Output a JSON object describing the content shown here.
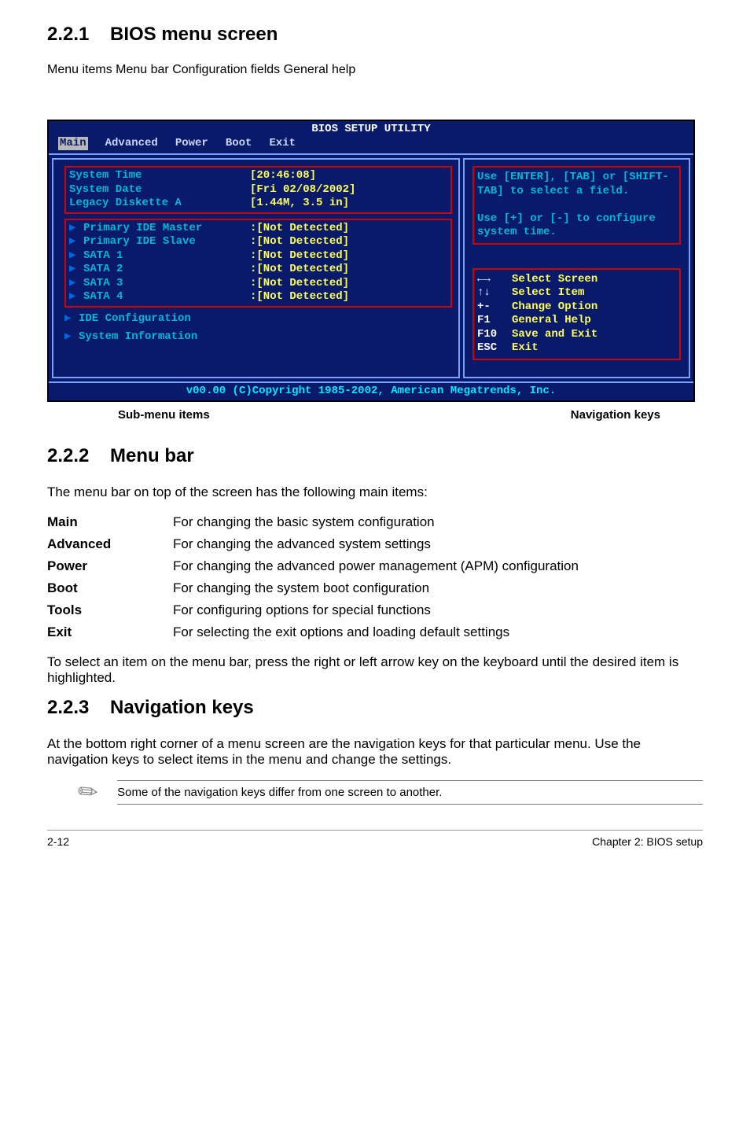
{
  "section221": {
    "num": "2.2.1",
    "title": "BIOS menu screen"
  },
  "anno": {
    "menu_items": "Menu items",
    "menu_bar": "Menu bar",
    "config_fields": "Configuration fields",
    "general_help": "General help",
    "sub_menu": "Sub-menu items",
    "nav_keys": "Navigation keys"
  },
  "bios": {
    "title": "BIOS SETUP UTILITY",
    "menubar": [
      "Main",
      "Advanced",
      "Power",
      "Boot",
      "Exit"
    ],
    "cfg": {
      "time_l": "System Time",
      "time_v": "[20:46:08]",
      "date_l": "System Date",
      "date_v": "[Fri 02/08/2002]",
      "disk_l": "Legacy Diskette A",
      "disk_v": "[1.44M, 3.5 in]"
    },
    "items": [
      {
        "l": "Primary IDE Master",
        "v": ":[Not Detected]"
      },
      {
        "l": "Primary IDE Slave",
        "v": ":[Not Detected]"
      },
      {
        "l": "SATA 1",
        "v": ":[Not Detected]"
      },
      {
        "l": "SATA 2",
        "v": ":[Not Detected]"
      },
      {
        "l": "SATA 3",
        "v": ":[Not Detected]"
      },
      {
        "l": "SATA 4",
        "v": ":[Not Detected]"
      }
    ],
    "sub": [
      "IDE Configuration",
      "System Information"
    ],
    "help": "Use [ENTER], [TAB] or [SHIFT-TAB] to select a field.\n\nUse [+] or [-] to configure system time.",
    "nav": [
      {
        "k": "←→",
        "d": "Select Screen"
      },
      {
        "k": "↑↓",
        "d": "Select Item"
      },
      {
        "k": "+-",
        "d": "Change Option"
      },
      {
        "k": "F1",
        "d": "General Help"
      },
      {
        "k": "F10",
        "d": "Save and Exit"
      },
      {
        "k": "ESC",
        "d": "Exit"
      }
    ],
    "copyright": "v00.00 (C)Copyright 1985-2002, American Megatrends, Inc."
  },
  "section222": {
    "num": "2.2.2",
    "title": "Menu bar",
    "intro": "The menu bar on top of the screen has the following main items:",
    "rows": [
      {
        "k": "Main",
        "d": "For changing the basic system configuration"
      },
      {
        "k": "Advanced",
        "d": "For changing the advanced system settings"
      },
      {
        "k": "Power",
        "d": "For changing the advanced power management (APM) configuration"
      },
      {
        "k": "Boot",
        "d": "For changing the system boot configuration"
      },
      {
        "k": "Tools",
        "d": "For configuring options for special functions"
      },
      {
        "k": "Exit",
        "d": "For selecting the exit options and loading default settings"
      }
    ],
    "outro": "To select an item on the menu bar, press the right or left arrow key on the keyboard until the desired item is highlighted."
  },
  "section223": {
    "num": "2.2.3",
    "title": "Navigation keys",
    "text": "At the bottom right corner of a menu screen are the navigation keys for that particular menu. Use the navigation keys to select items in the menu and change the settings.",
    "note": "Some of the navigation keys differ from one screen to another."
  },
  "footer": {
    "left": "2-12",
    "right": "Chapter 2: BIOS setup"
  }
}
